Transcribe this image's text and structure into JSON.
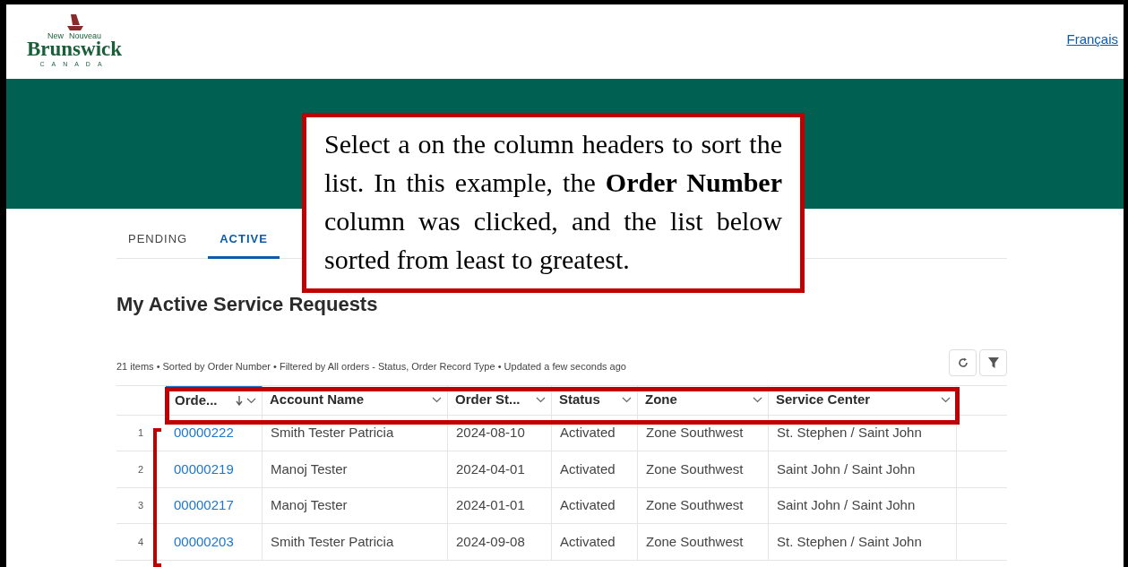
{
  "logo": {
    "top_left": "New",
    "top_right": "Nouveau",
    "name": "Brunswick",
    "country": "CANADA"
  },
  "language_link": "Français",
  "tabs": [
    {
      "label": "PENDING",
      "selected": false
    },
    {
      "label": "ACTIVE",
      "selected": true
    }
  ],
  "heading": "My Active Service Requests",
  "summary": "21 items • Sorted by Order Number • Filtered by All orders - Status, Order Record Type • Updated a few seconds ago",
  "table": {
    "columns": [
      {
        "label": "Orde...",
        "sorted": true
      },
      {
        "label": "Account Name",
        "sorted": false
      },
      {
        "label": "Order St...",
        "sorted": false
      },
      {
        "label": "Status",
        "sorted": false
      },
      {
        "label": "Zone",
        "sorted": false
      },
      {
        "label": "Service Center",
        "sorted": false
      }
    ],
    "rows": [
      {
        "number": "1",
        "cells": [
          "00000222",
          "Smith Tester Patricia",
          "2024-08-10",
          "Activated",
          "Zone Southwest",
          "St. Stephen / Saint John"
        ]
      },
      {
        "number": "2",
        "cells": [
          "00000219",
          "Manoj Tester",
          "2024-04-01",
          "Activated",
          "Zone Southwest",
          "Saint John / Saint John"
        ]
      },
      {
        "number": "3",
        "cells": [
          "00000217",
          "Manoj Tester",
          "2024-01-01",
          "Activated",
          "Zone Southwest",
          "Saint John / Saint John"
        ]
      },
      {
        "number": "4",
        "cells": [
          "00000203",
          "Smith Tester Patricia",
          "2024-09-08",
          "Activated",
          "Zone Southwest",
          "St. Stephen / Saint John"
        ]
      }
    ]
  },
  "callout": "Select a on the column headers to sort the list. In this example, the **Order Number** column was clicked, and the list below sorted from least to greatest."
}
